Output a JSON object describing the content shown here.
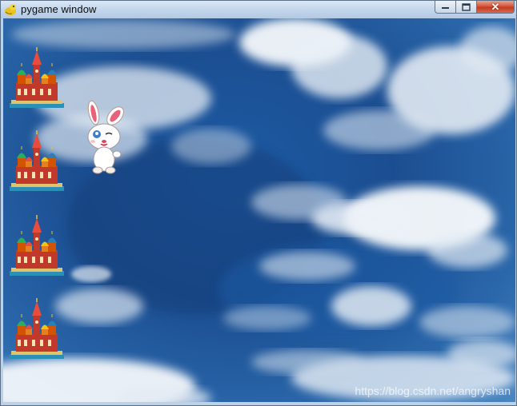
{
  "window": {
    "title": "pygame window",
    "buttons": {
      "minimize": "minimize",
      "maximize": "maximize",
      "close": "✕"
    }
  },
  "game": {
    "background": "sky with clouds",
    "sprites": [
      {
        "name": "castle-sprite-1",
        "icon": "castle-icon"
      },
      {
        "name": "castle-sprite-2",
        "icon": "castle-icon"
      },
      {
        "name": "castle-sprite-3",
        "icon": "castle-icon"
      },
      {
        "name": "castle-sprite-4",
        "icon": "castle-icon"
      },
      {
        "name": "rabbit-sprite",
        "icon": "rabbit-icon"
      }
    ]
  },
  "watermark": "https://blog.csdn.net/angryshan",
  "colors": {
    "sky": "#1b4e91",
    "close": "#c23b21",
    "titlebar": "#c3d6ec"
  }
}
